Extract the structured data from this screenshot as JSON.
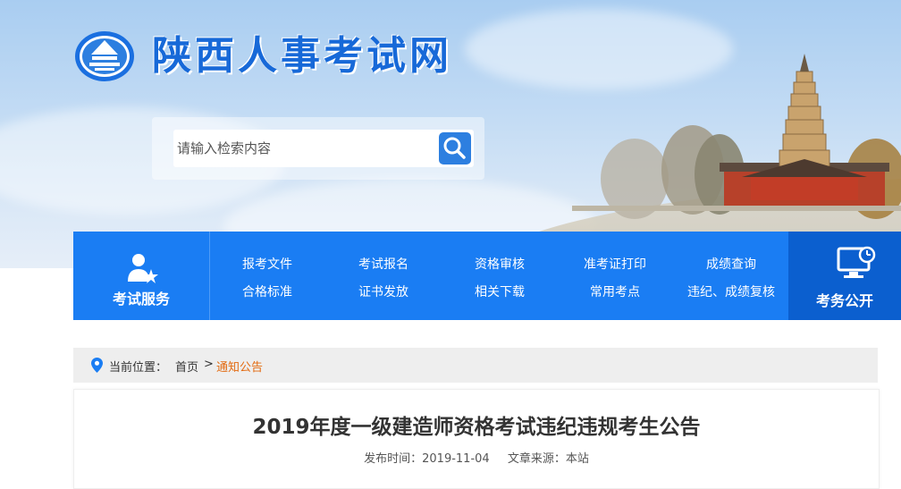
{
  "site": {
    "title": "陕西人事考试网"
  },
  "search": {
    "placeholder": "请输入检索内容"
  },
  "nav": {
    "left_label": "考试服务",
    "right_label": "考务公开",
    "links": [
      "报考文件",
      "考试报名",
      "资格审核",
      "准考证打印",
      "成绩查询",
      "合格标准",
      "证书发放",
      "相关下载",
      "常用考点",
      "违纪、成绩复核"
    ]
  },
  "breadcrumb": {
    "prefix": "当前位置：",
    "home": "首页",
    "sep": ">",
    "current": "通知公告"
  },
  "article": {
    "title": "2019年度一级建造师资格考试违纪违规考生公告",
    "publish_label": "发布时间：",
    "publish_date": "2019-11-04",
    "source_label": "文章来源：",
    "source": "本站"
  },
  "colors": {
    "primary": "#1a7df3",
    "dark": "#0b5fcf",
    "title": "#1769d8",
    "accent": "#e36b12"
  }
}
